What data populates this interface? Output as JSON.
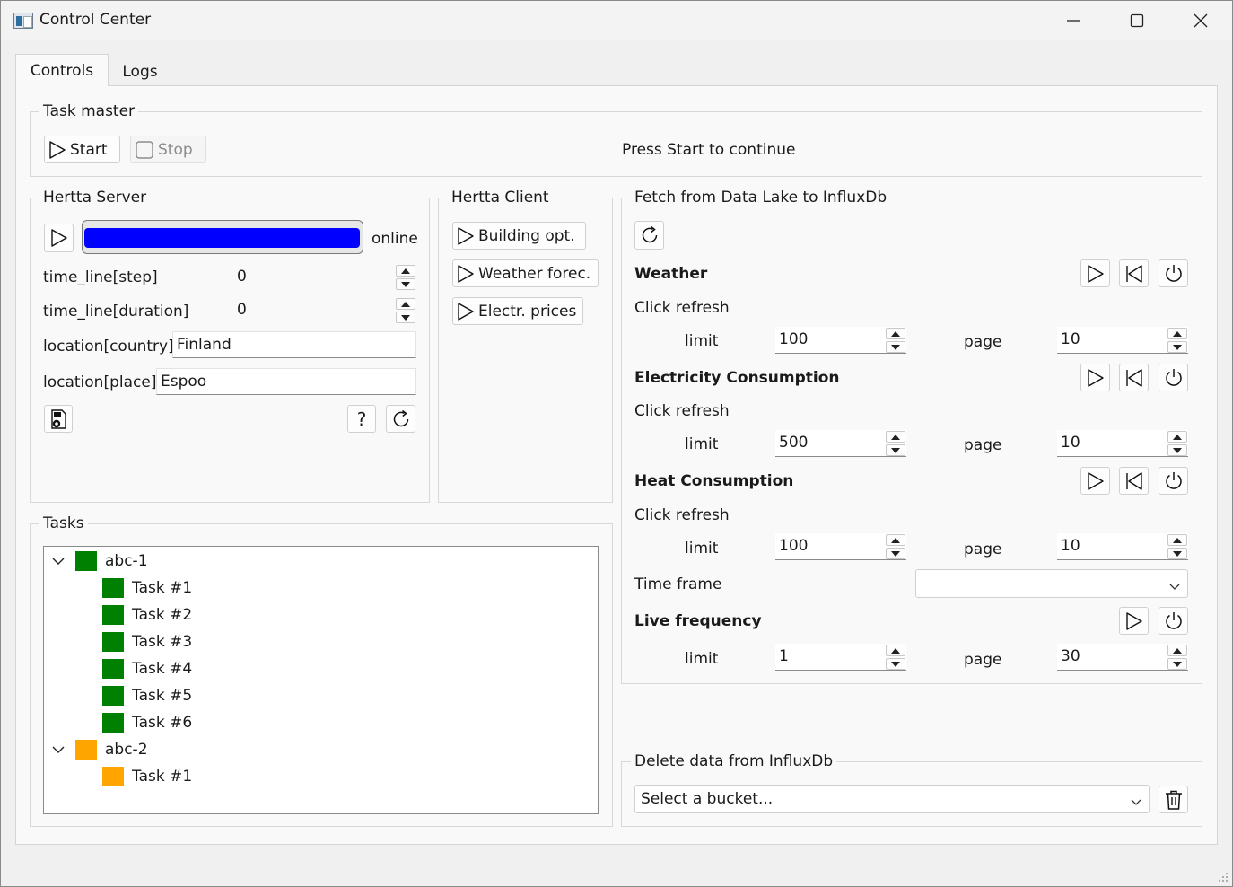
{
  "window": {
    "title": "Control Center",
    "minimize_icon": "minimize-icon",
    "maximize_icon": "maximize-icon",
    "close_icon": "close-icon"
  },
  "tabs": [
    {
      "label": "Controls",
      "selected": true
    },
    {
      "label": "Logs",
      "selected": false
    }
  ],
  "task_master": {
    "title": "Task master",
    "start_label": "Start",
    "stop_label": "Stop",
    "status": "Press Start to continue"
  },
  "hertta_server": {
    "title": "Hertta Server",
    "status": "online",
    "progress": 1.0,
    "progress_color": "#0000ff",
    "fields": {
      "time_line_step": {
        "label": "time_line[step]",
        "value": "0"
      },
      "time_line_duration": {
        "label": "time_line[duration]",
        "value": "0"
      },
      "location_country": {
        "label": "location[country]",
        "value": "Finland"
      },
      "location_place": {
        "label": "location[place]",
        "value": "Espoo"
      }
    },
    "help_label": "?"
  },
  "hertta_client": {
    "title": "Hertta Client",
    "buttons": [
      "Building opt.",
      "Weather forec.",
      "Electr. prices"
    ]
  },
  "fetch": {
    "title": "Fetch from Data Lake to InfluxDb",
    "sections": [
      {
        "name": "Weather",
        "status": "Click refresh",
        "limit_label": "limit",
        "limit": "100",
        "page_label": "page",
        "page": "10"
      },
      {
        "name": "Electricity Consumption",
        "status": "Click refresh",
        "limit_label": "limit",
        "limit": "500",
        "page_label": "page",
        "page": "10"
      },
      {
        "name": "Heat Consumption",
        "status": "Click refresh",
        "limit_label": "limit",
        "limit": "100",
        "page_label": "page",
        "page": "10"
      }
    ],
    "time_frame_label": "Time frame",
    "time_frame_value": "",
    "live": {
      "name": "Live frequency",
      "limit_label": "limit",
      "limit": "1",
      "page_label": "page",
      "page": "30"
    }
  },
  "tasks": {
    "title": "Tasks",
    "groups": [
      {
        "name": "abc-1",
        "color": "#008000",
        "expanded": true,
        "children": [
          {
            "name": "Task #1",
            "color": "#008000"
          },
          {
            "name": "Task #2",
            "color": "#008000"
          },
          {
            "name": "Task #3",
            "color": "#008000"
          },
          {
            "name": "Task #4",
            "color": "#008000"
          },
          {
            "name": "Task #5",
            "color": "#008000"
          },
          {
            "name": "Task #6",
            "color": "#008000"
          }
        ]
      },
      {
        "name": "abc-2",
        "color": "#ffa500",
        "expanded": true,
        "children": [
          {
            "name": "Task #1",
            "color": "#ffa500"
          }
        ]
      }
    ]
  },
  "delete": {
    "title": "Delete data from InfluxDb",
    "bucket_placeholder": "Select a bucket..."
  }
}
